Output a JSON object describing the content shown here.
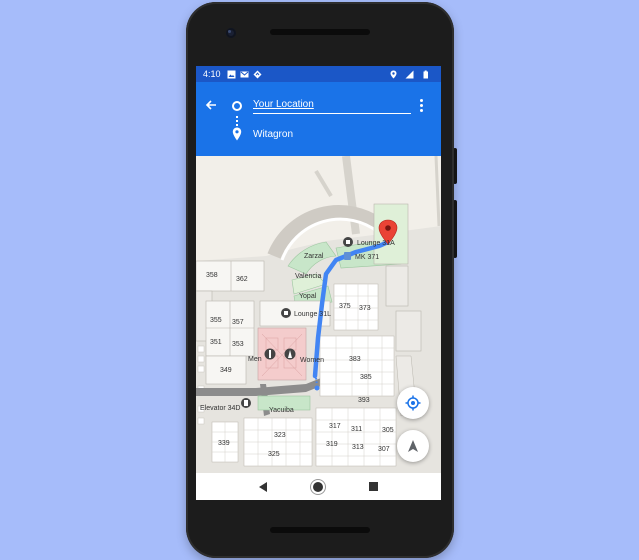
{
  "status_bar": {
    "time": "4:10",
    "left_icons": [
      "image-icon",
      "gmail-icon",
      "location-diamond-icon"
    ],
    "right_icons": [
      "location-pin-icon",
      "signal-icon",
      "battery-icon"
    ]
  },
  "directions": {
    "back_icon": "arrow-left-icon",
    "from_value": "Your Location",
    "to_value": "Witagron",
    "overflow_icon": "more-vert-icon",
    "accent_color": "#1a73e8"
  },
  "map": {
    "labels": {
      "lounge_31a": "Lounge 31A",
      "mk_371": "MK 371",
      "zarzal": "Zarzal",
      "valencia": "Valencia",
      "yopal": "Yopal",
      "r358": "358",
      "r362": "362",
      "r355": "355",
      "r357": "357",
      "r351": "351",
      "r353": "353",
      "r349": "349",
      "lounge_31l": "Lounge 31L",
      "r375": "375",
      "r373": "373",
      "men": "Men",
      "women": "Women",
      "r383": "383",
      "r385": "385",
      "r393": "393",
      "elevator": "Elevator 34D",
      "yacuiba": "Yacuiba",
      "r317": "317",
      "r311": "311",
      "r305": "305",
      "r323": "323",
      "r339": "339",
      "r319": "319",
      "r313": "313",
      "r307": "307",
      "r325": "325"
    },
    "route_color": "#4285f4",
    "destination_color": "#ea4335"
  },
  "controls": {
    "locate_icon": "my-location-icon",
    "compass_icon": "compass-arrow-icon"
  },
  "nav_bar": {
    "back_icon": "nav-back-icon",
    "home_icon": "nav-home-icon",
    "recents_icon": "nav-recents-icon"
  }
}
